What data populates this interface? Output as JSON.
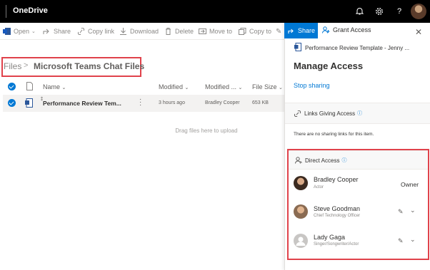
{
  "app": {
    "title": "OneDrive"
  },
  "topbar": {
    "icons": [
      "bell-icon",
      "gear-icon",
      "help-icon",
      "profile-avatar"
    ]
  },
  "commandbar": {
    "items": [
      {
        "label": "Open",
        "icon": "word-icon"
      },
      {
        "label": "Share",
        "icon": "share-icon"
      },
      {
        "label": "Copy link",
        "icon": "link-icon"
      },
      {
        "label": "Download",
        "icon": "download-icon"
      },
      {
        "label": "Delete",
        "icon": "delete-icon"
      },
      {
        "label": "Move to",
        "icon": "move-icon"
      },
      {
        "label": "Copy to",
        "icon": "copy-icon"
      }
    ]
  },
  "breadcrumb": {
    "root": "Files",
    "separator": ">",
    "current": "Microsoft Teams Chat Files"
  },
  "table": {
    "headers": {
      "name": "Name",
      "modified": "Modified",
      "modified_by": "Modified ...",
      "size": "File Size"
    },
    "rows": [
      {
        "name": "Performance Review Tem...",
        "modified": "3 hours ago",
        "modified_by": "Bradley Cooper",
        "size": "653 KB"
      }
    ]
  },
  "drop_hint": "Drag files here to upload",
  "panel": {
    "tabs": {
      "share": "Share",
      "grant": "Grant Access"
    },
    "file_name": "Performance Review Template - Jenny ...",
    "heading": "Manage Access",
    "stop_sharing": "Stop sharing",
    "links_section": {
      "title": "Links Giving Access",
      "empty": "There are no sharing links for this item."
    },
    "direct_section": {
      "title": "Direct Access"
    },
    "people": [
      {
        "name": "Bradley Cooper",
        "role": "Actor",
        "permission": "Owner"
      },
      {
        "name": "Steve Goodman",
        "role": "Chief Technology Officer",
        "permission": ""
      },
      {
        "name": "Lady Gaga",
        "role": "Singer/Songwriter/Actor",
        "permission": ""
      }
    ]
  },
  "colors": {
    "accent": "#0078d4",
    "highlight": "#e0424b",
    "topbar": "#000000"
  }
}
